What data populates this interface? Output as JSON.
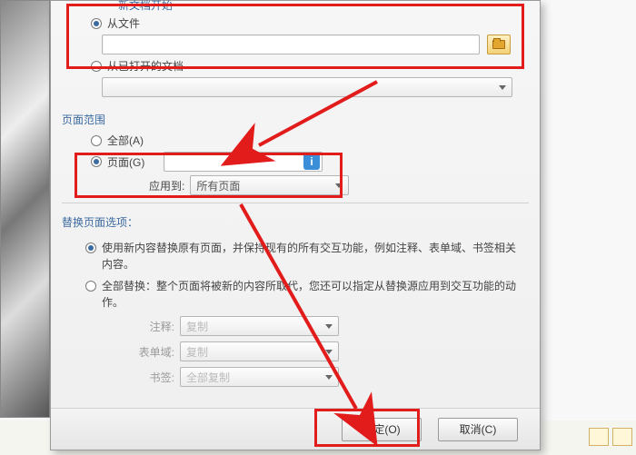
{
  "source": {
    "group_title_partial": "新文档开始",
    "from_file_label": "从文件",
    "from_open_doc_label": "从已打开的文档",
    "file_path_value": "",
    "open_doc_selected": ""
  },
  "page_range": {
    "group_title": "页面范围",
    "all_label": "全部(A)",
    "pages_label": "页面(G)",
    "pages_value": "",
    "info_glyph": "i",
    "apply_to_label": "应用到:",
    "apply_to_selected": "所有页面"
  },
  "replace_options": {
    "group_title": "替换页面选项：",
    "opt_keep_label": "使用新内容替换原有页面，并保持现有的所有交互功能，例如注释、表单域、书签相关内容。",
    "opt_full_label": "全部替换：整个页面将被新的内容所取代，您还可以指定从替换源应用到交互功能的动作。",
    "annotation_label": "注释:",
    "annotation_value": "复制",
    "form_label": "表单域:",
    "form_value": "复制",
    "bookmark_label": "书签:",
    "bookmark_value": "全部复制"
  },
  "buttons": {
    "ok": "确定(O)",
    "cancel": "取消(C)"
  }
}
